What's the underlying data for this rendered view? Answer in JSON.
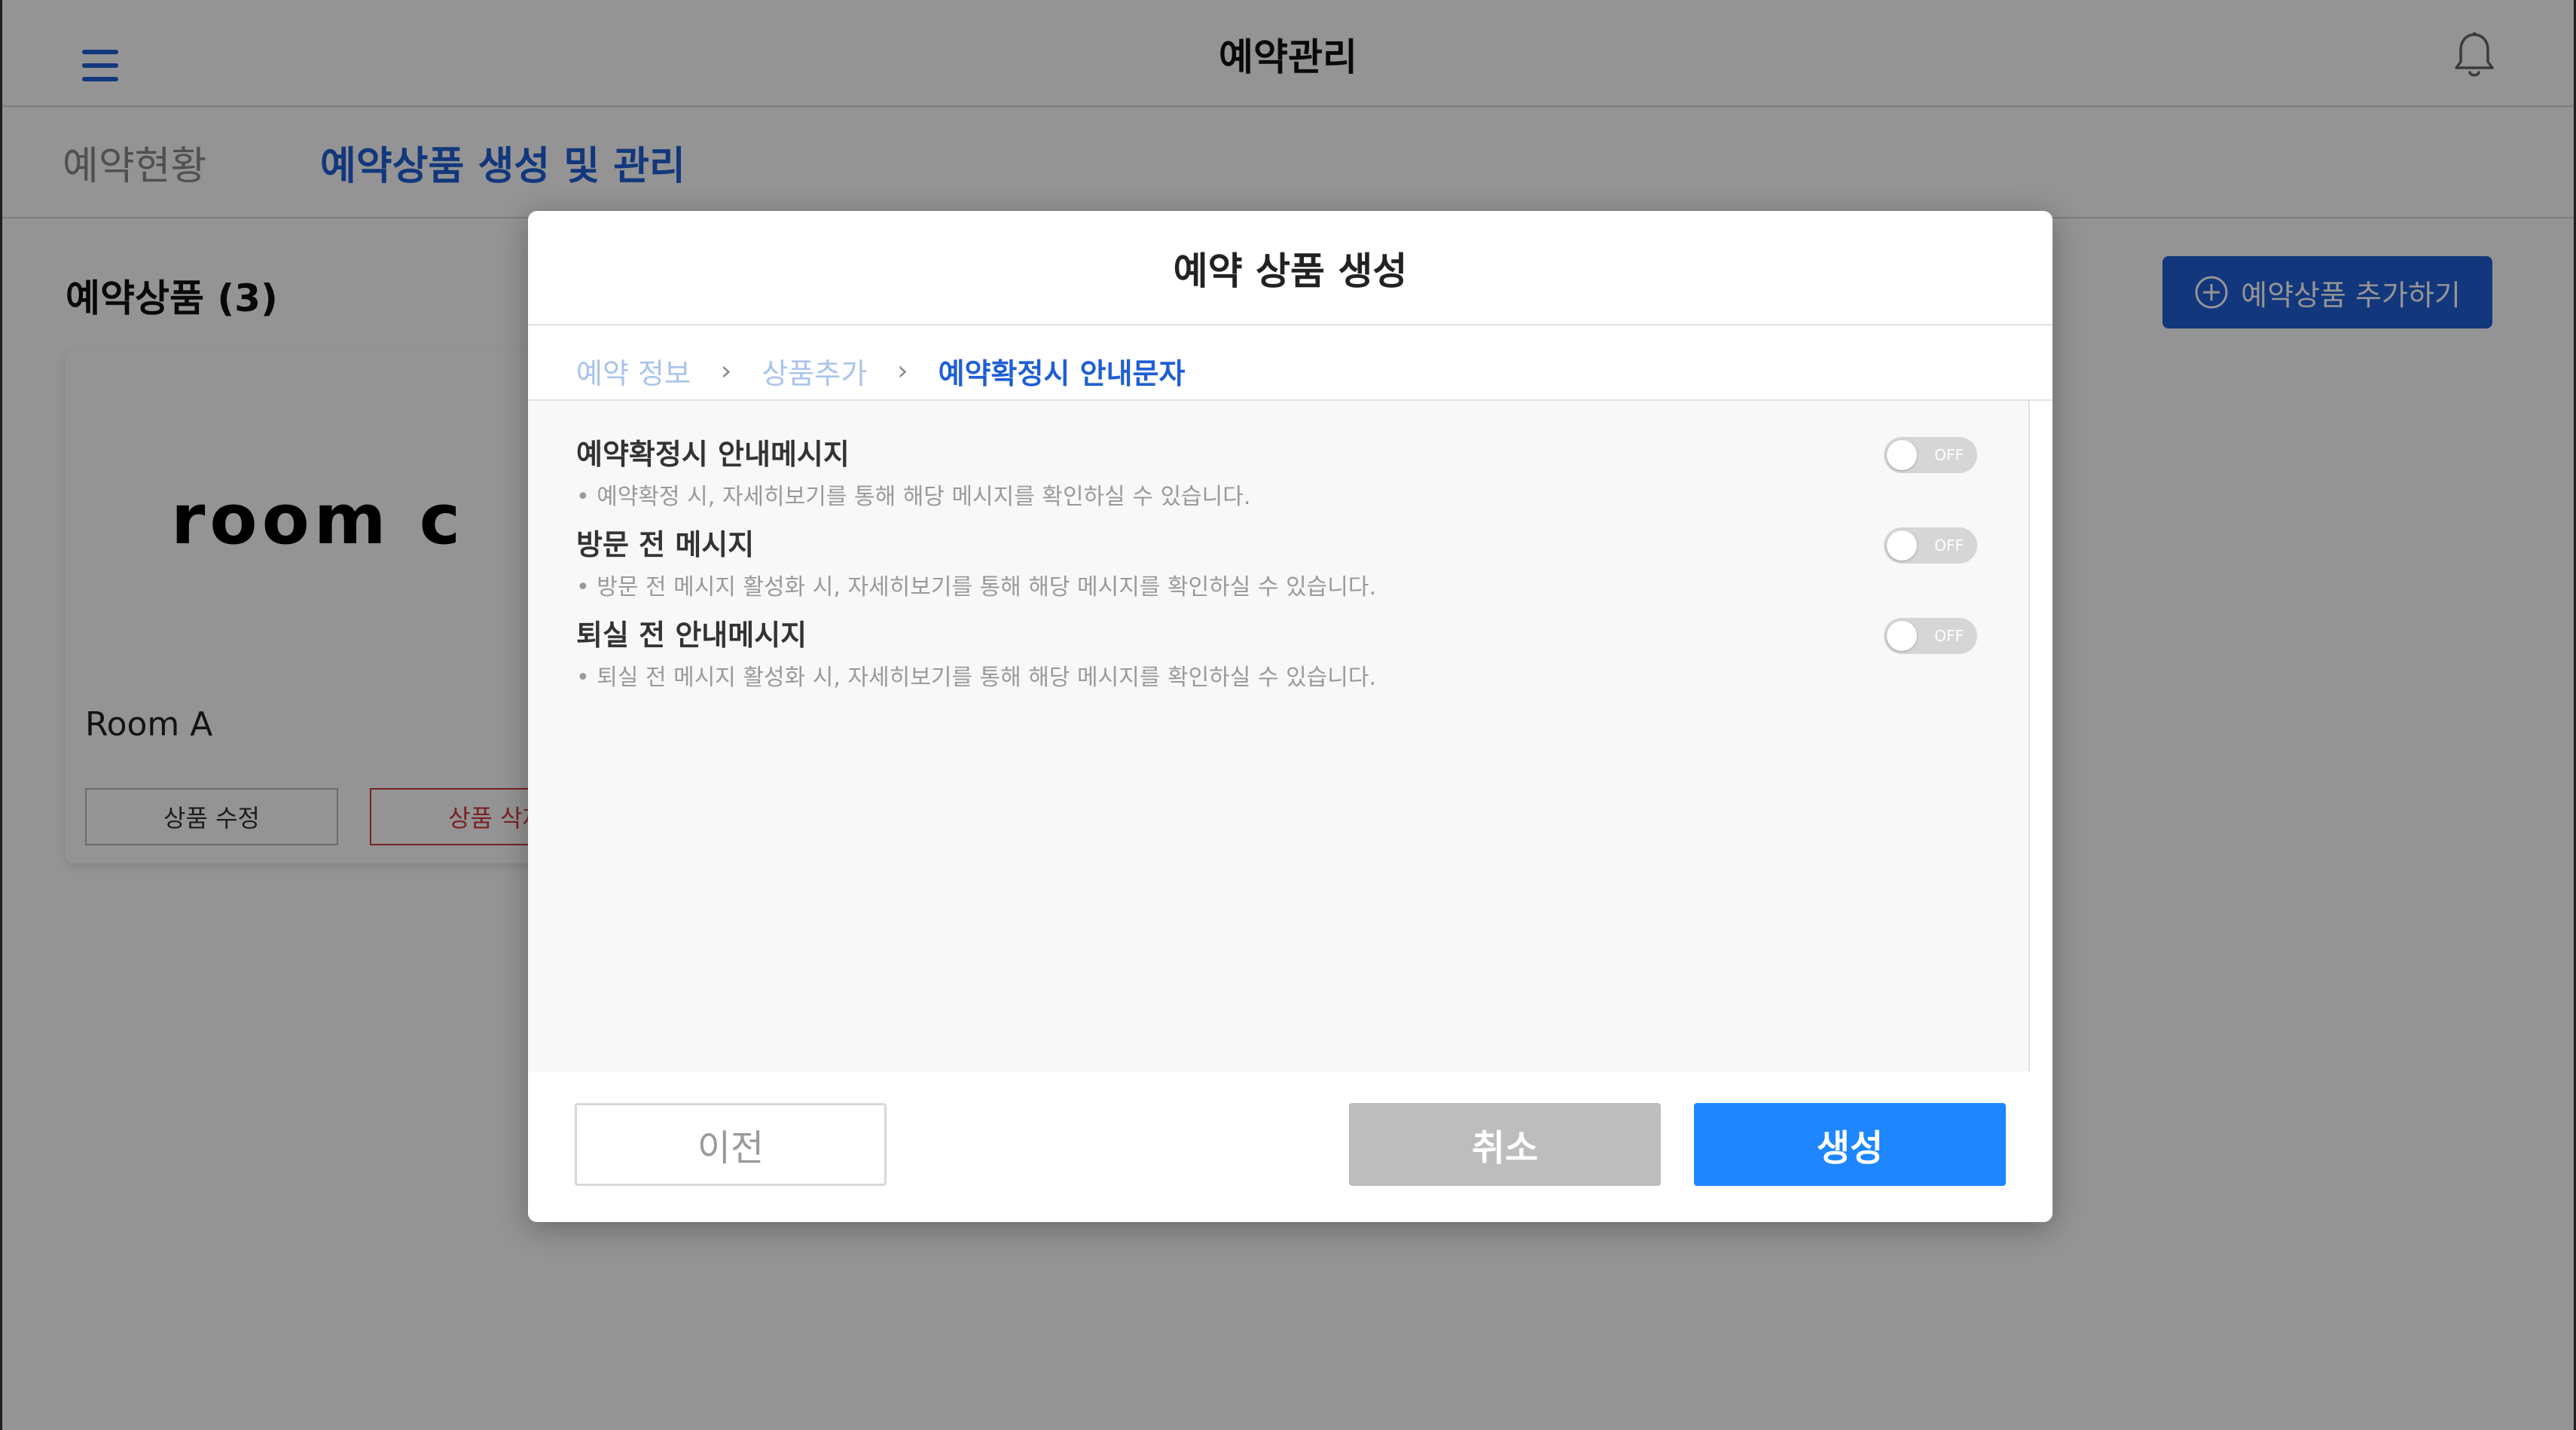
{
  "header": {
    "title": "예약관리"
  },
  "tabs": [
    {
      "label": "예약현황",
      "active": false
    },
    {
      "label": "예약상품 생성 및 관리",
      "active": true
    }
  ],
  "main": {
    "section_title": "예약상품 (3)",
    "add_button_label": "예약상품 추가하기",
    "card": {
      "logo_text": "room c",
      "name": "Room A",
      "edit_label": "상품 수정",
      "delete_label": "상품 삭제"
    }
  },
  "modal": {
    "title": "예약 상품 생성",
    "steps": [
      {
        "label": "예약 정보",
        "active": false
      },
      {
        "label": "상품추가",
        "active": false
      },
      {
        "label": "예약확정시 안내문자",
        "active": true
      }
    ],
    "step_separator": "›",
    "settings": [
      {
        "title": "예약확정시 안내메시지",
        "description": "• 예약확정 시, 자세히보기를 통해 해당 메시지를 확인하실 수 있습니다.",
        "toggle_state": "OFF"
      },
      {
        "title": "방문 전 메시지",
        "description": "• 방문 전 메시지 활성화 시, 자세히보기를 통해 해당 메시지를 확인하실 수 있습니다.",
        "toggle_state": "OFF"
      },
      {
        "title": "퇴실 전 안내메시지",
        "description": "• 퇴실 전 메시지 활성화 시, 자세히보기를 통해 해당 메시지를 확인하실 수 있습니다.",
        "toggle_state": "OFF"
      }
    ],
    "buttons": {
      "prev": "이전",
      "cancel": "취소",
      "create": "생성"
    }
  },
  "colors": {
    "accent": "#1f5fd6",
    "primary_button": "#1e86ff",
    "disabled_button": "#bdbdbd",
    "danger": "#d23a3a"
  }
}
